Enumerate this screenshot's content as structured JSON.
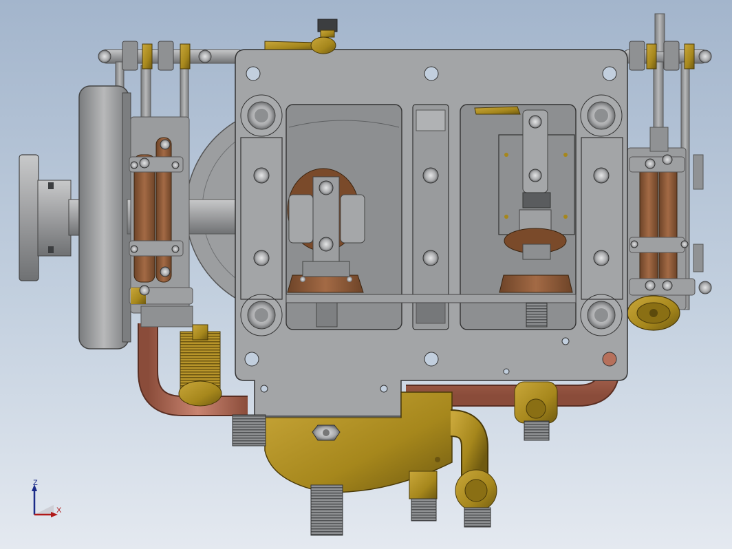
{
  "viewport": {
    "background_top": "#a3b5cc",
    "background_bottom": "#e4e9f0"
  },
  "model": {
    "materials": {
      "steel": "#a2a3a4",
      "steel_dark": "#6e7072",
      "copper": "#b6705b",
      "brass": "#a6871c",
      "bronze": "#8c5a37"
    }
  },
  "triad": {
    "z_label": "Z",
    "x_label": "X",
    "z_color": "#1a2a88",
    "x_color": "#b01818"
  }
}
